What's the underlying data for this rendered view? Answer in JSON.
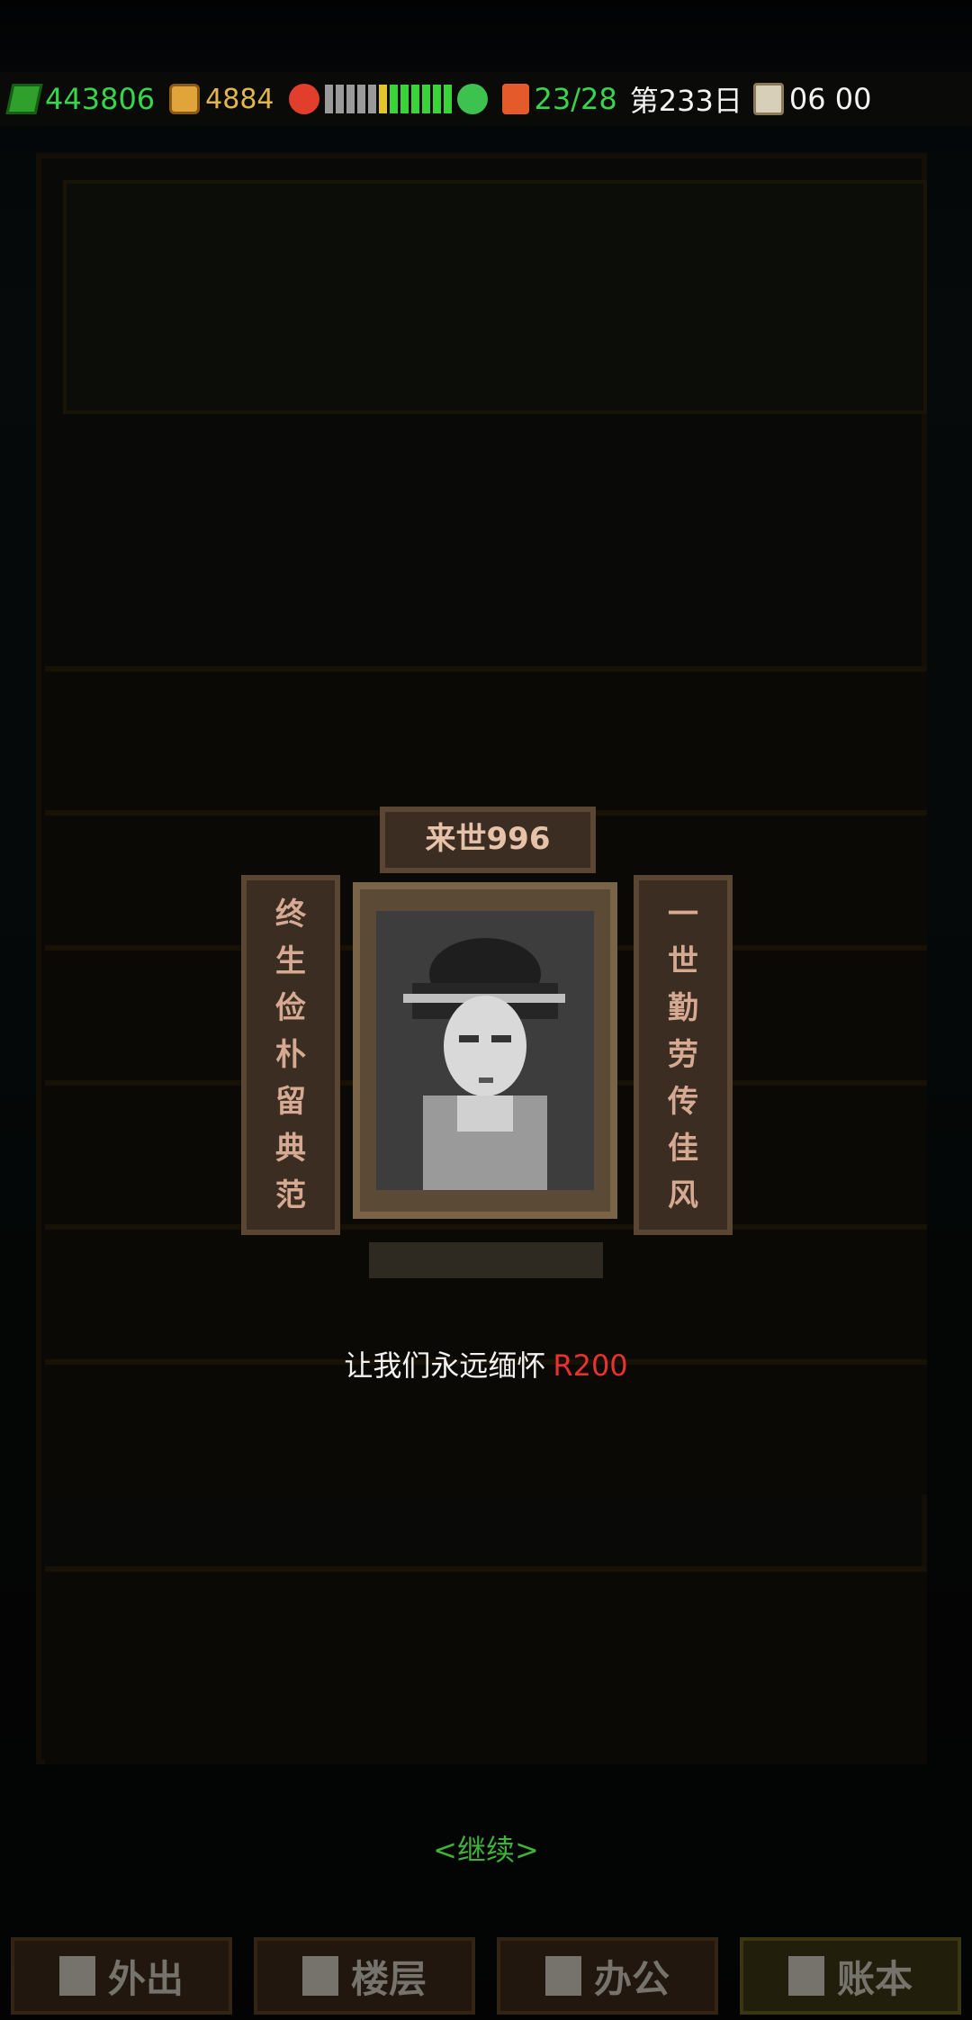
{
  "hud": {
    "money": "443806",
    "coins": "4884",
    "mood_meter_levels": [
      "gray",
      "gray",
      "gray",
      "gray",
      "gray",
      "yellow",
      "green",
      "green",
      "green",
      "green",
      "green",
      "green"
    ],
    "residents": "23/28",
    "day": "第233日",
    "time": "06 00"
  },
  "memorial": {
    "name": "来世996",
    "left_couplet": [
      "终",
      "生",
      "俭",
      "朴",
      "留",
      "典",
      "范"
    ],
    "right_couplet": [
      "一",
      "世",
      "勤",
      "劳",
      "传",
      "佳",
      "风"
    ],
    "message": "让我们永远缅怀",
    "price": "R200"
  },
  "continue_label": "<继续>",
  "tabs": [
    {
      "label": "外出",
      "icon": "door-icon"
    },
    {
      "label": "楼层",
      "icon": "floors-icon"
    },
    {
      "label": "办公",
      "icon": "book-icon"
    },
    {
      "label": "账本",
      "icon": "ledger-icon"
    }
  ],
  "colors": {
    "money": "#39d44b",
    "coins": "#e2b64c",
    "price": "#e8322b",
    "continue": "#3fb23a",
    "banner_text": "#d6aa92"
  }
}
